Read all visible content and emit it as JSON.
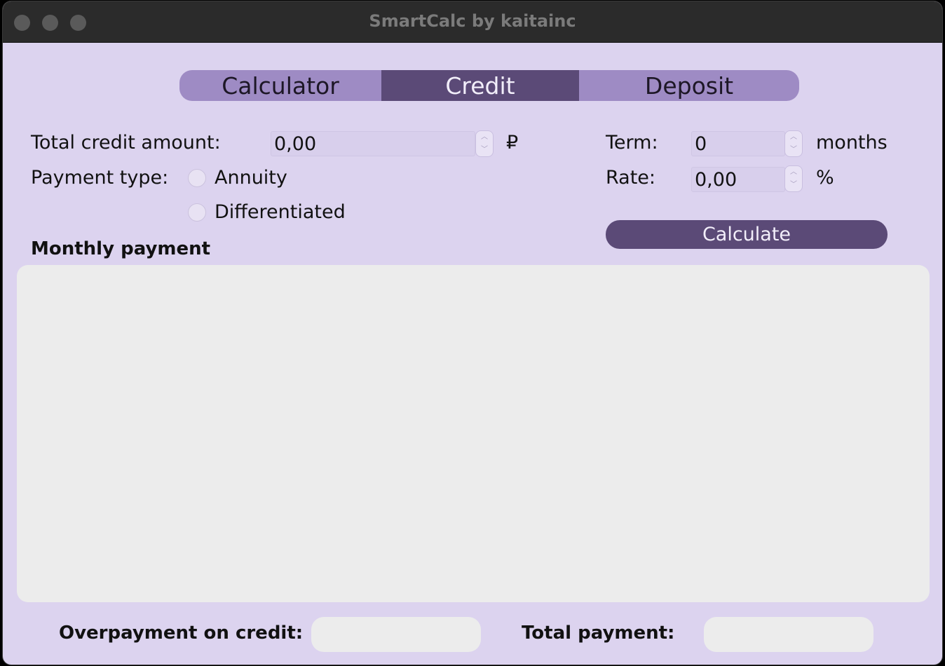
{
  "window": {
    "title": "SmartCalc by kaitainc"
  },
  "tabs": [
    {
      "label": "Calculator"
    },
    {
      "label": "Credit"
    },
    {
      "label": "Deposit"
    }
  ],
  "active_tab": "Credit",
  "form": {
    "total_credit_label": "Total credit amount:",
    "total_credit_value": "0,00",
    "currency_symbol": "₽",
    "term_label": "Term:",
    "term_value": "0",
    "term_unit": "months",
    "rate_label": "Rate:",
    "rate_value": "0,00",
    "rate_unit": "%",
    "payment_type_label": "Payment type:",
    "payment_options": [
      {
        "label": "Annuity",
        "selected": false
      },
      {
        "label": "Differentiated",
        "selected": false
      }
    ],
    "calculate_label": "Calculate"
  },
  "results": {
    "monthly_payment_label": "Monthly payment",
    "overpayment_label": "Overpayment on credit:",
    "total_payment_label": "Total payment:"
  },
  "colors": {
    "background": "#dcd3ef",
    "tab_bar": "#9e8bc4",
    "accent": "#5b4a77",
    "panel": "#ececec"
  }
}
